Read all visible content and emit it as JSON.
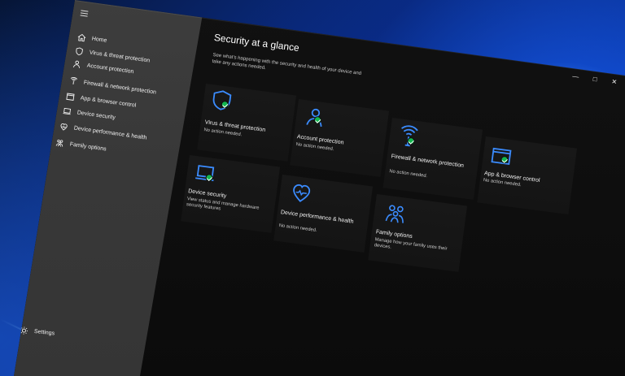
{
  "app": {
    "title": "Security at a glance",
    "subtitle": "See what's happening with the security and health of your device and take any actions needed."
  },
  "window_controls": {
    "minimize": "—",
    "maximize": "□",
    "close": "✕"
  },
  "sidebar": {
    "items": [
      {
        "label": "Home",
        "icon": "home-icon"
      },
      {
        "label": "Virus & threat protection",
        "icon": "shield-icon"
      },
      {
        "label": "Account protection",
        "icon": "person-icon"
      },
      {
        "label": "Firewall & network protection",
        "icon": "wifi-icon"
      },
      {
        "label": "App & browser control",
        "icon": "browser-icon"
      },
      {
        "label": "Device security",
        "icon": "laptop-icon"
      },
      {
        "label": "Device performance & health",
        "icon": "heart-icon"
      },
      {
        "label": "Family options",
        "icon": "family-icon"
      }
    ],
    "settings_label": "Settings"
  },
  "cards": [
    {
      "title": "Virus & threat protection",
      "status": "No action needed.",
      "icon": "shield-icon",
      "has_check": true
    },
    {
      "title": "Account protection",
      "status": "No action needed.",
      "icon": "person-icon",
      "has_check": true
    },
    {
      "title": "Firewall & network protection",
      "status": "No action needed.",
      "icon": "wifi-icon",
      "has_check": true
    },
    {
      "title": "App & browser control",
      "status": "No action needed.",
      "icon": "browser-icon",
      "has_check": true
    },
    {
      "title": "Device security",
      "status": "View status and manage hardware security features",
      "icon": "laptop-icon",
      "has_check": true
    },
    {
      "title": "Device performance & health",
      "status": "No action needed.",
      "icon": "heart-icon",
      "has_check": false
    },
    {
      "title": "Family options",
      "status": "Manage how your family uses their devices.",
      "icon": "family-icon",
      "has_check": false
    }
  ],
  "colors": {
    "accent": "#3b8cff",
    "success": "#13b64f",
    "window": "#111111",
    "sidebar": "#3a3a3a"
  }
}
